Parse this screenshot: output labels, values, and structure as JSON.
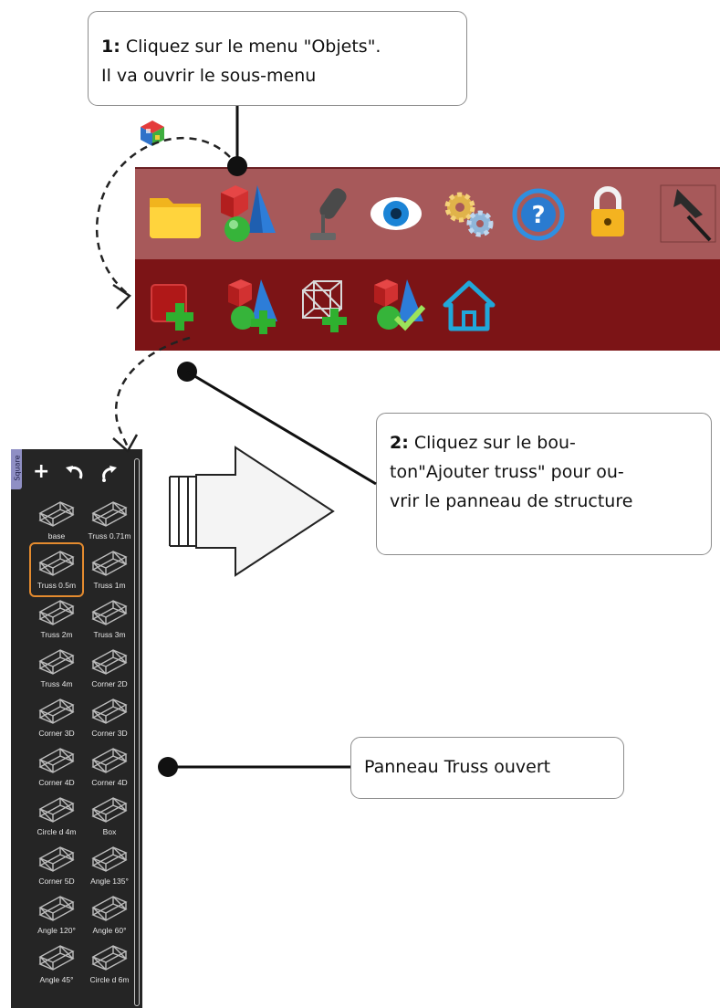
{
  "callouts": {
    "step1": {
      "num": "1:",
      "line1": " Cliquez sur le menu \"Objets\".",
      "line2": "Il va ouvrir le sous-menu"
    },
    "step2": {
      "num": "2:",
      "line1": " Cliquez sur le bou-",
      "line2": "ton\"Ajouter truss\" pour ou-",
      "line3": "vrir le panneau de structure"
    },
    "step3": {
      "text": "Panneau Truss ouvert"
    }
  },
  "panel": {
    "tab_label": "Square",
    "tools": [
      "plus-icon",
      "undo-icon",
      "redo-icon"
    ],
    "items": [
      {
        "label": "base"
      },
      {
        "label": "Truss 0.71m"
      },
      {
        "label": "Truss 0.5m",
        "selected": true
      },
      {
        "label": "Truss 1m"
      },
      {
        "label": "Truss 2m"
      },
      {
        "label": "Truss 3m"
      },
      {
        "label": "Truss 4m"
      },
      {
        "label": "Corner 2D"
      },
      {
        "label": "Corner 3D"
      },
      {
        "label": "Corner 3D"
      },
      {
        "label": "Corner 4D"
      },
      {
        "label": "Corner 4D"
      },
      {
        "label": "Circle d 4m"
      },
      {
        "label": "Box"
      },
      {
        "label": "Corner 5D"
      },
      {
        "label": "Angle 135°"
      },
      {
        "label": "Angle 120°"
      },
      {
        "label": "Angle 60°"
      },
      {
        "label": "Angle 45°"
      },
      {
        "label": "Circle d 6m"
      }
    ]
  },
  "menu_bar": {
    "icons": [
      "folder-icon",
      "objects-icon",
      "light-icon",
      "eye-icon",
      "gears-icon",
      "help-icon",
      "lock-icon",
      "pin-icon"
    ]
  },
  "sub_bar": {
    "icons": [
      "add-box-icon",
      "add-objects-icon",
      "add-truss-icon",
      "check-objects-icon",
      "home-icon"
    ]
  },
  "colors": {
    "menu_bar": "#a7595a",
    "sub_bar": "#7c1416",
    "panel": "#252525",
    "selection": "#e48b2f"
  }
}
